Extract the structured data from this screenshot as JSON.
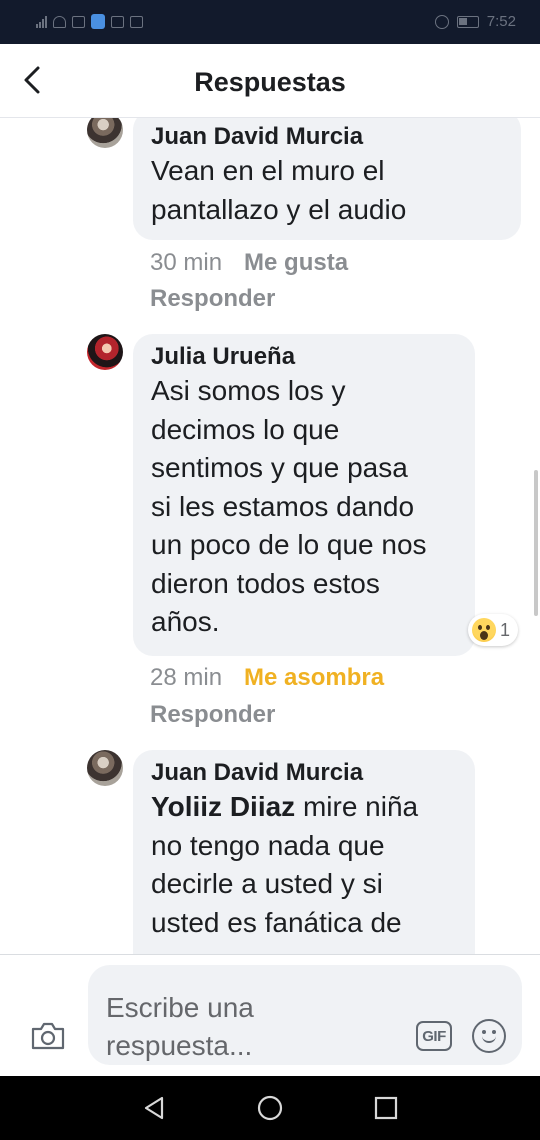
{
  "status_bar": {
    "time": "7:52",
    "left_icons": [
      "signal-icon",
      "wifi-icon",
      "mail-icon",
      "shield-app-icon",
      "gallery-icon",
      "facebook-icon"
    ],
    "right_icons": [
      "alarm-icon",
      "battery-icon"
    ]
  },
  "header": {
    "title": "Respuestas",
    "back_icon": "chevron-left-icon"
  },
  "comments": [
    {
      "author": "Juan David Murcia",
      "text": "Vean en el muro el\npantallazo y el audio",
      "time": "30 min",
      "reaction_label": "Me gusta",
      "reply_label": "Responder"
    },
    {
      "author": "Julia Urueña",
      "text": "Asi somos los y\ndecimos lo que\nsentimos y que pasa\nsi les estamos dando\nun poco de lo que nos\ndieron todos estos\naños.",
      "time": "28 min",
      "reaction_label": "Me asombra",
      "reaction_count": "1",
      "reaction_icon": "wow-emoji-icon",
      "reply_label": "Responder"
    },
    {
      "author": "Juan David Murcia",
      "mention": "Yoliiz Diiaz",
      "text": " mire niña\nno tengo nada que\ndecirle a usted y si\nusted es fanática de"
    }
  ],
  "composer": {
    "placeholder": "Escribe una\nrespuesta...",
    "gif_label": "GIF",
    "icons": [
      "camera-icon",
      "gif-icon",
      "emoji-icon"
    ]
  },
  "nav_bar": {
    "icons": [
      "back-triangle-icon",
      "home-circle-icon",
      "recents-square-icon"
    ]
  },
  "colors": {
    "status_bar_bg": "#121a2c",
    "bubble_bg": "#f0f2f5",
    "wow_reaction": "#f0b122",
    "meta_text": "#8a8d91"
  }
}
